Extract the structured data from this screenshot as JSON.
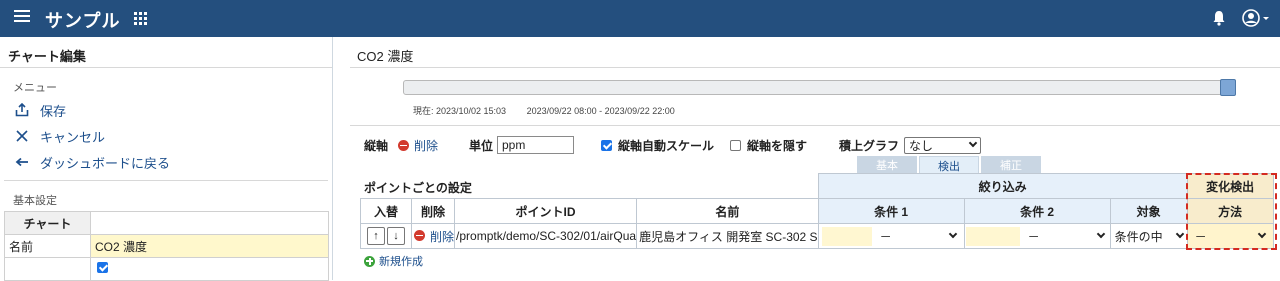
{
  "app": {
    "title": "サンプル"
  },
  "left": {
    "panel_title": "チャート編集",
    "menu_section": "メニュー",
    "menu_items": [
      {
        "label": "保存",
        "icon": "save-upload-icon"
      },
      {
        "label": "キャンセル",
        "icon": "close-icon"
      },
      {
        "label": "ダッシュボードに戻る",
        "icon": "back-arrow-icon"
      }
    ],
    "basic_section": "基本設定",
    "table": {
      "header": "チャート",
      "rows": [
        {
          "label": "名前",
          "value": "CO2 濃度"
        },
        {
          "label": "",
          "checked": true
        }
      ]
    }
  },
  "main": {
    "title": "CO2 濃度",
    "slider": {
      "position_fraction": 1.0
    },
    "now_label": "現在: 2023/10/02 15:03",
    "range_label": "2023/09/22 08:00 - 2023/09/22 22:00",
    "axis_label": "縦軸",
    "delete_label": "削除",
    "unit_label": "単位",
    "unit_value": "ppm",
    "auto_scale_label": "縦軸自動スケール",
    "auto_scale_checked": true,
    "hide_axis_label": "縦軸を隠す",
    "hide_axis_checked": false,
    "stack_label": "積上グラフ",
    "stack_value": "なし",
    "tabs": [
      {
        "label": "基本",
        "active": false
      },
      {
        "label": "検出",
        "active": true
      },
      {
        "label": "補正",
        "active": false
      }
    ],
    "per_point_label": "ポイントごとの設定",
    "group_filter": "絞り込み",
    "group_change": "変化検出",
    "columns": {
      "reorder": "入替",
      "delete": "削除",
      "point_id": "ポイントID",
      "name": "名前",
      "cond1": "条件 1",
      "cond2": "条件 2",
      "target": "対象",
      "method": "方法"
    },
    "row": {
      "delete": "削除",
      "point_id": "/promptk/demo/SC-302/01/airQua",
      "name": "鹿児島オフィス  開発室 SC-302 S",
      "cond1_op": "－",
      "cond2_op": "－",
      "target": "条件の中",
      "method": "－"
    },
    "new_label": "新規作成"
  },
  "colors": {
    "topbar": "#244f7e",
    "link": "#1d4f8c",
    "highlight": "#d42a20"
  }
}
